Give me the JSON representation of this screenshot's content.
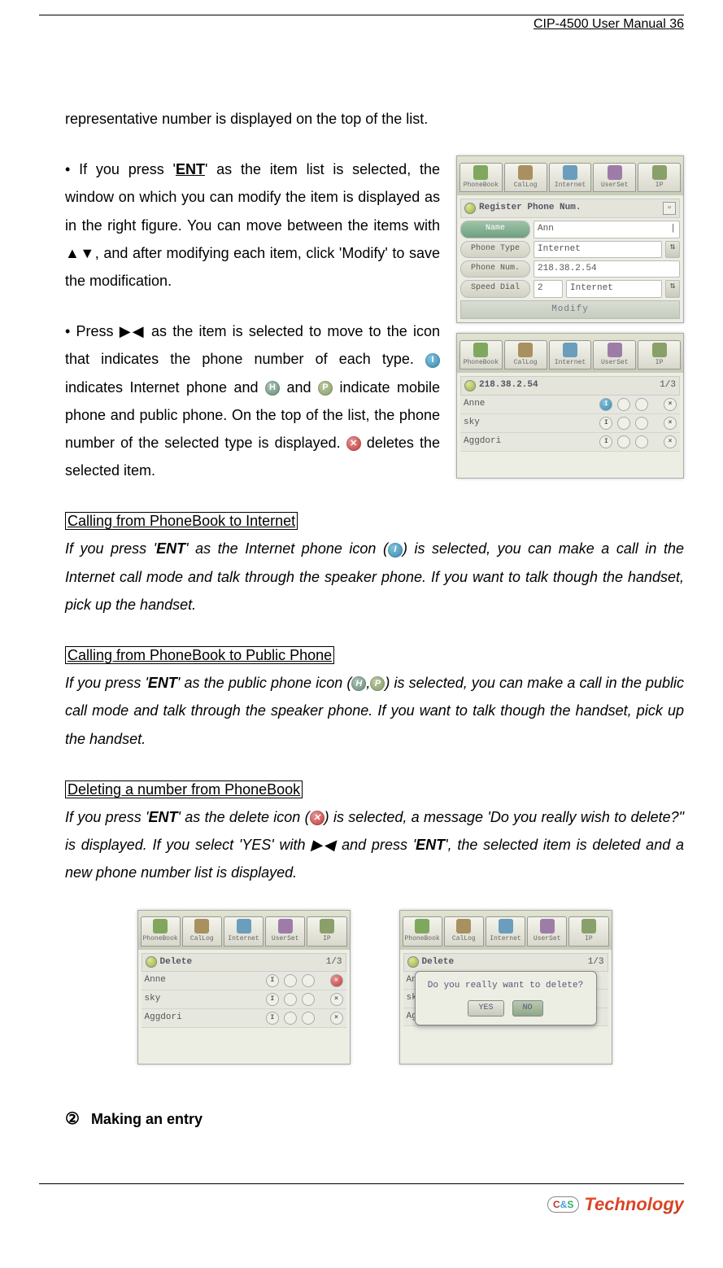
{
  "header": {
    "product": "CIP-4500 User Manual",
    "page": "36"
  },
  "p_intro": "representative number is displayed on the top of the list.",
  "p_ent_1": "• If you press '",
  "ent": "ENT",
  "p_ent_2": "' as the item list is selected, the window on which you can modify the item is displayed as in the right figure. You can move between the items with ▲▼, and after modifying each item, click 'Modify' to save the modification.",
  "p_press_1": "• Press ▶◀ as the item is selected to move to the icon that indicates the phone number of each type. ",
  "p_press_2": " indicates Internet phone and ",
  "p_press_3": " and ",
  "p_press_4": " indicate mobile phone and public phone. On the top of the list, the phone number of the selected type is displayed. ",
  "p_press_5": " deletes the selected item.",
  "sec1_title": "Calling from PhoneBook to Internet",
  "sec1_1": "If you press '",
  "sec1_2": "' as the Internet phone icon (",
  "sec1_3": ") is selected, you can make a call in the Internet call mode and talk through the speaker phone. If you want to talk though the handset, pick up the handset.",
  "sec2_title": "Calling from PhoneBook to Public Phone",
  "sec2_1": "If you press '",
  "sec2_2": "' as the public phone icon (",
  "sec2_3": ",",
  "sec2_4": ") is selected, you can make a call in the public call mode and talk through the speaker phone. If you want to talk though the handset, pick up the handset.",
  "sec3_title": "Deleting a number from PhoneBook",
  "sec3_1": "If you press '",
  "sec3_2": "' as the delete icon (",
  "sec3_3": ") is selected, a message 'Do you really wish to delete?\" is displayed. If you select 'YES' with ▶◀ and press '",
  "sec3_4": "', the selected item is deleted and a new phone number list is displayed.",
  "num2": "②",
  "h_making": "Making an entry",
  "tabs": [
    "PhoneBook",
    "CalLog",
    "Internet",
    "UserSet",
    "IP"
  ],
  "mockA": {
    "title": "Register Phone Num.",
    "rows": {
      "name_lbl": "Name",
      "name_val": "Ann",
      "type_lbl": "Phone Type",
      "type_val": "Internet",
      "num_lbl": "Phone Num.",
      "num_val": "218.38.2.54",
      "sd_lbl": "Speed Dial",
      "sd_val1": "2",
      "sd_val2": "Internet"
    },
    "modify": "Modify"
  },
  "mockB": {
    "ip": "218.38.2.54",
    "counter": "1/3",
    "items": [
      "Anne",
      "sky",
      "Aggdori"
    ]
  },
  "mockC": {
    "title": "Delete",
    "counter": "1/3",
    "items": [
      "Anne",
      "sky",
      "Aggdori"
    ]
  },
  "mockD": {
    "title": "Delete",
    "counter": "1/3",
    "items": [
      "An",
      "sk",
      "Ag"
    ],
    "dialog_msg": "Do you really want to delete?",
    "yes": "YES",
    "no": "NO"
  },
  "logo": {
    "c": "C",
    "amp": "&",
    "s": "S",
    "word": "Technology"
  }
}
